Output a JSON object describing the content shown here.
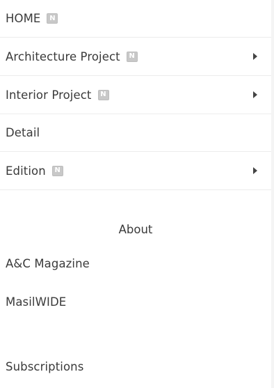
{
  "menu": {
    "new_badge": "N",
    "items": [
      {
        "label": "HOME",
        "badge": true,
        "submenu": false
      },
      {
        "label": "Architecture Project",
        "badge": true,
        "submenu": true
      },
      {
        "label": "Interior Project",
        "badge": true,
        "submenu": true
      },
      {
        "label": "Detail",
        "badge": false,
        "submenu": false
      },
      {
        "label": "Edition",
        "badge": true,
        "submenu": true
      }
    ],
    "about": {
      "heading": "About",
      "items": [
        {
          "label": "A&C Magazine"
        },
        {
          "label": "MasilWIDE"
        }
      ]
    },
    "subscriptions": {
      "label": "Subscriptions"
    }
  }
}
